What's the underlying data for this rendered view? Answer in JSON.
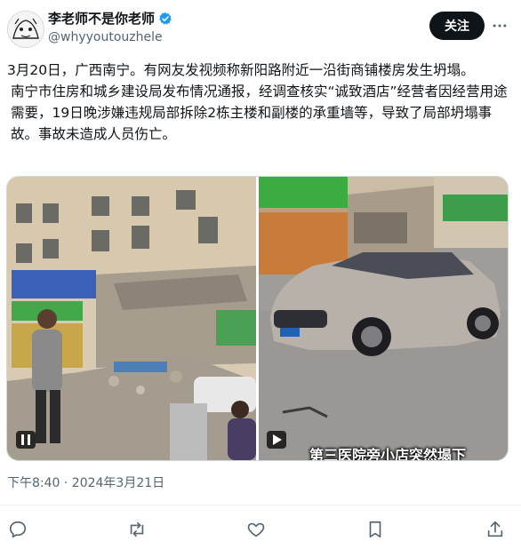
{
  "user": {
    "display_name": "李老师不是你老师",
    "handle": "@whyyoutouzhele",
    "verified_icon": "verified-badge-icon"
  },
  "follow_button": {
    "label": "关注"
  },
  "more_icon": "more-horizontal-icon",
  "post": {
    "line1": "3月20日，广西南宁。有网友发视频称新阳路附近一沿街商铺楼房发生坍塌。",
    "line2": "南宁市住房和城乡建设局发布情况通报，经调查核实“诚致酒店”经营者因经营用途需要，19日晚涉嫌违规局部拆除2栋主楼和副楼的承重墙等，导致了局部坍塌事故。事故未造成人员伤亡。"
  },
  "media": {
    "left_video": {
      "control": "pause-icon"
    },
    "right_video": {
      "control": "play-icon",
      "caption": "第三医院旁小店突然塌下"
    }
  },
  "timestamp": "下午8:40 · 2024年3月21日",
  "actions": {
    "reply_icon": "reply-icon",
    "repost_icon": "repost-icon",
    "like_icon": "like-icon",
    "bookmark_icon": "bookmark-icon",
    "share_icon": "share-icon"
  },
  "colors": {
    "text": "#0f1419",
    "secondary": "#536471",
    "verified": "#1d9bf0",
    "button_bg": "#0f1419"
  }
}
